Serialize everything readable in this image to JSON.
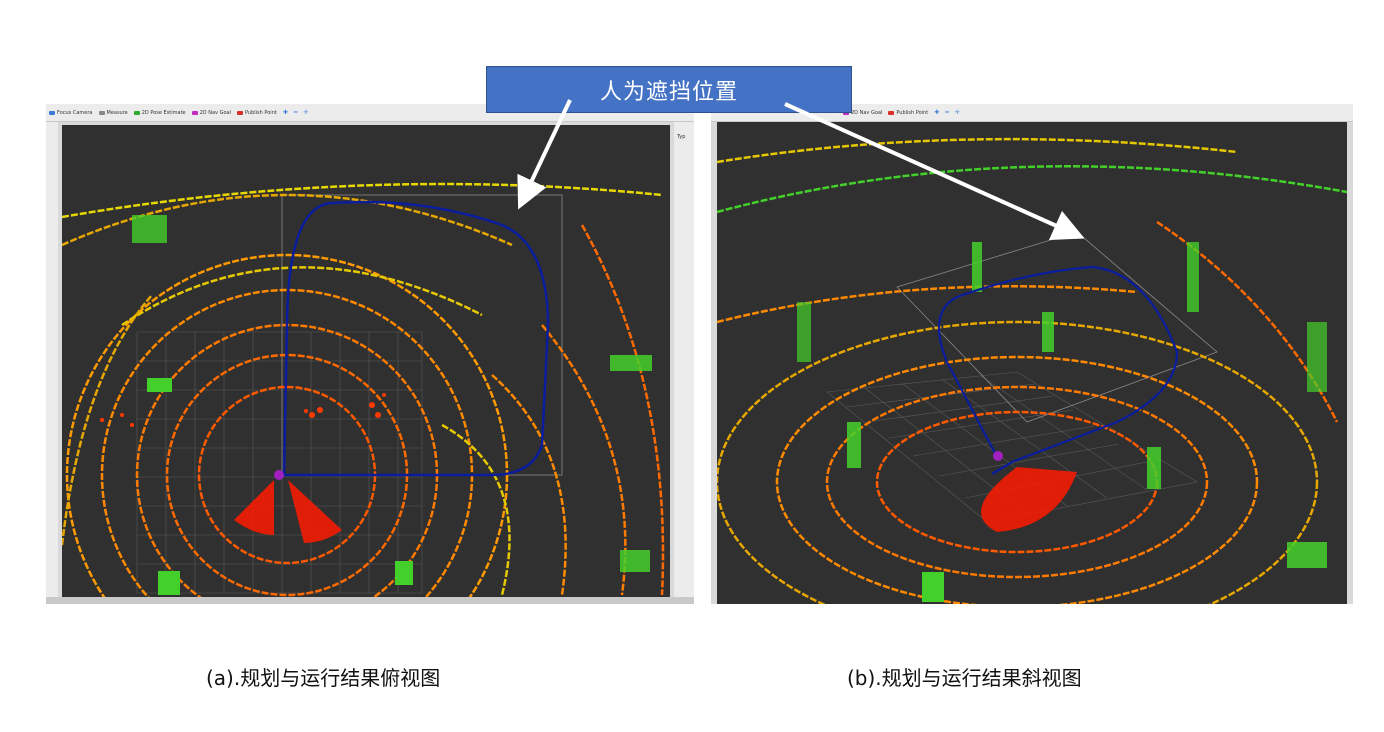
{
  "callout": {
    "text": "人为遮挡位置"
  },
  "panel_a": {
    "toolbar": [
      {
        "label": "Focus Camera",
        "icon": "focus-camera-icon",
        "color": "#3a7bd5"
      },
      {
        "label": "Measure",
        "icon": "measure-icon",
        "color": "#888888"
      },
      {
        "label": "2D Pose Estimate",
        "icon": "pose-estimate-icon",
        "color": "#2eaa2e"
      },
      {
        "label": "2D Nav Goal",
        "icon": "nav-goal-icon",
        "color": "#c02bc0"
      },
      {
        "label": "Publish Point",
        "icon": "publish-point-icon",
        "color": "#d93025"
      }
    ],
    "side_label": "Typ",
    "caption": "(a).规划与运行结果俯视图"
  },
  "panel_b": {
    "toolbar": [
      {
        "label": "2D Nav Goal",
        "icon": "nav-goal-icon",
        "color": "#c02bc0"
      },
      {
        "label": "Publish Point",
        "icon": "publish-point-icon",
        "color": "#d93025"
      }
    ],
    "caption": "(b).规划与运行结果斜视图"
  },
  "colors": {
    "viewport_bg": "#303030",
    "path": "#0a1d9e",
    "scan_near": "#ff2a00",
    "scan_mid": "#ff7a00",
    "scan_far": "#e6d800",
    "scan_green": "#44d02a",
    "robot": "#a020c0",
    "callout_bg": "#4472c4"
  }
}
